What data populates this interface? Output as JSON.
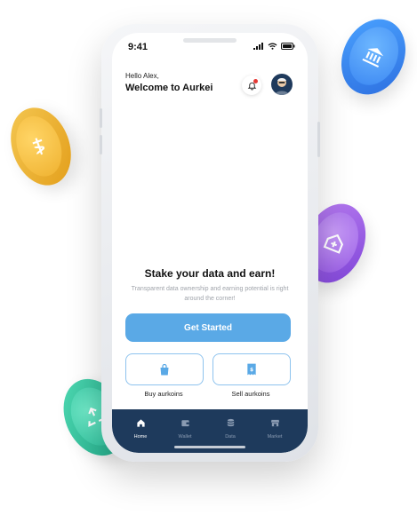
{
  "status": {
    "time": "9:41"
  },
  "header": {
    "greeting": "Hello Alex,",
    "welcome": "Welcome to Aurkei"
  },
  "hero": {
    "title": "Stake your data and earn!",
    "subtitle": "Transparent data ownership and earning potential is right around the corner!"
  },
  "cta": {
    "label": "Get Started"
  },
  "actions": {
    "buy_label": "Buy aurkoins",
    "sell_label": "Sell aurkoins"
  },
  "tabs": [
    {
      "label": "Home",
      "icon": "home-icon",
      "active": true
    },
    {
      "label": "Wallet",
      "icon": "wallet-icon",
      "active": false
    },
    {
      "label": "Data",
      "icon": "database-icon",
      "active": false
    },
    {
      "label": "Market",
      "icon": "store-icon",
      "active": false
    }
  ],
  "colors": {
    "accent": "#5aa9e6",
    "tabbar": "#1e3a5c",
    "notification_dot": "#e53935",
    "coin_gold": "#efb12f",
    "coin_blue": "#3a86f2",
    "coin_purple": "#9659e4",
    "coin_green": "#2cbf9b"
  }
}
